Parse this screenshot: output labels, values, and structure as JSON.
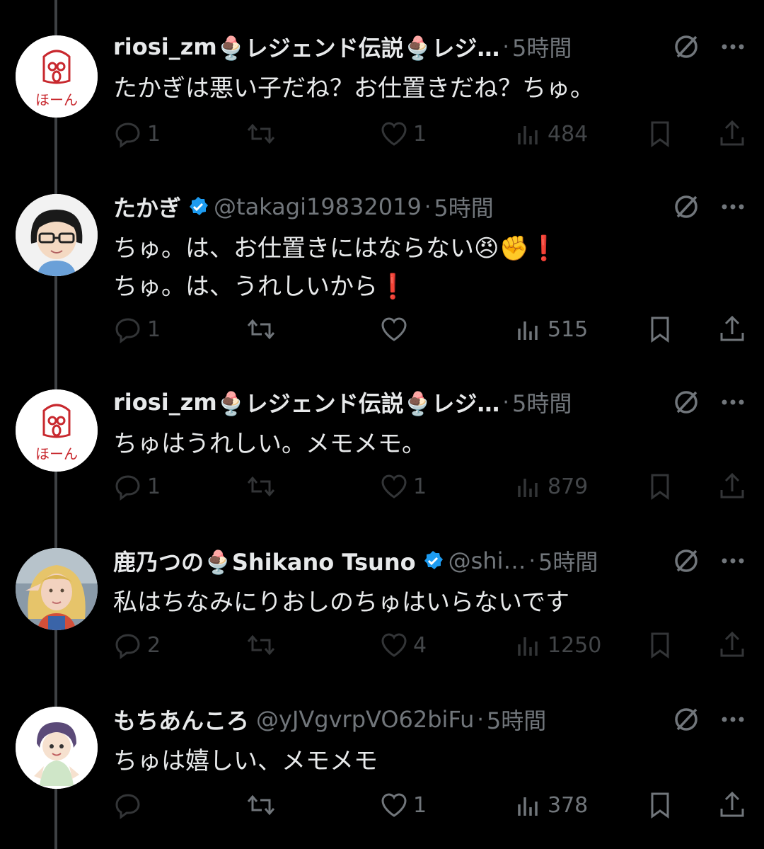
{
  "colors": {
    "background": "#000000",
    "text": "#e7e9ea",
    "secondary": "#71767b",
    "verified": "#1d9bf0",
    "red_mark": "#e0263b"
  },
  "tweets": [
    {
      "name": "riosi_zm",
      "name_suffix": "🍨レジェンド伝説🍨レジ…",
      "handle": "",
      "dot": "·",
      "time": "5時間",
      "verified": false,
      "lines": [
        "たかぎは悪い子だね？お仕置きだね？ちゅ。"
      ],
      "replies": "1",
      "reposts": "",
      "likes": "1",
      "views": "484",
      "avatar": "hoon-logo",
      "dim": true
    },
    {
      "name": "たかぎ",
      "name_suffix": "",
      "handle": "@takagi19832019",
      "dot": "·",
      "time": "5時間",
      "verified": true,
      "lines": [
        "ちゅ。は、お仕置きにはならない😠✊❗",
        "ちゅ。は、うれしいから❗"
      ],
      "replies": "1",
      "reposts": "",
      "likes": "",
      "views": "515",
      "avatar": "glasses-person",
      "dim": false
    },
    {
      "name": "riosi_zm",
      "name_suffix": "🍨レジェンド伝説🍨レジ…",
      "handle": "",
      "dot": "·",
      "time": "5時間",
      "verified": false,
      "lines": [
        "ちゅはうれしい。メモメモ。"
      ],
      "replies": "1",
      "reposts": "",
      "likes": "1",
      "views": "879",
      "avatar": "hoon-logo",
      "dim": true
    },
    {
      "name": "鹿乃つの🍨Shikano Tsuno",
      "name_suffix": "",
      "handle": "@shi…",
      "dot": "·",
      "time": "5時間",
      "verified": true,
      "lines": [
        "私はちなみにりおしのちゅはいらないです"
      ],
      "replies": "2",
      "reposts": "",
      "likes": "4",
      "views": "1250",
      "avatar": "cosplay-photo",
      "dim": true
    },
    {
      "name": "もちあんころ",
      "name_suffix": "",
      "handle": "@yJVgvrpVO62biFu",
      "dot": "·",
      "time": "5時間",
      "verified": false,
      "lines": [
        "ちゅは嬉しい、メモメモ"
      ],
      "replies": "",
      "reposts": "",
      "likes": "1",
      "views": "378",
      "avatar": "anime-character",
      "dim": false
    }
  ],
  "hoon_logo_text": "ほーん"
}
